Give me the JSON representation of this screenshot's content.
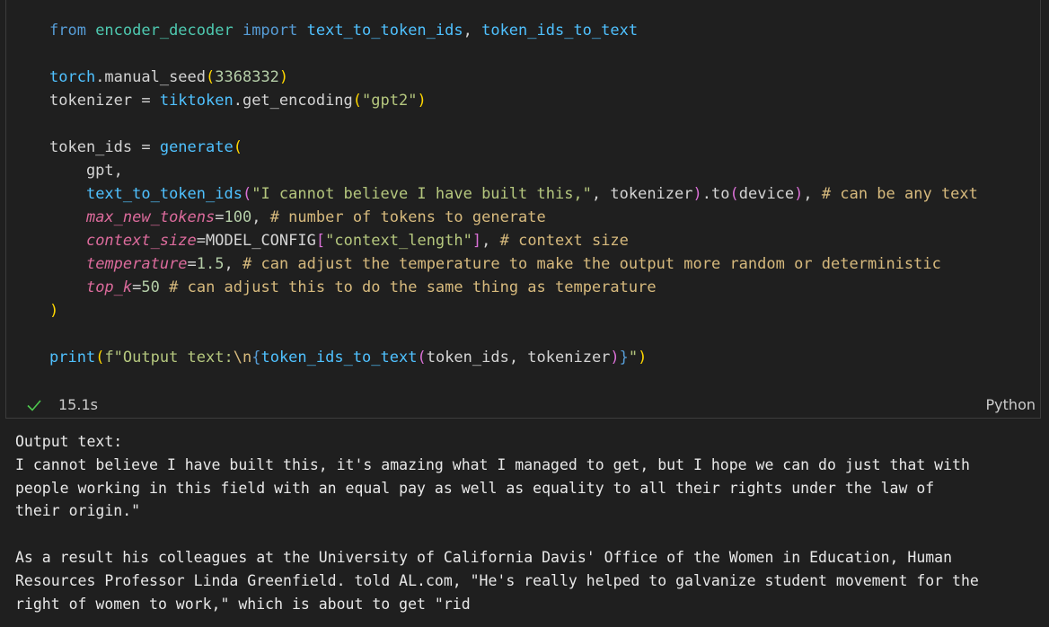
{
  "code_cell": {
    "lines": [
      [
        [
          "kw",
          "from "
        ],
        [
          "mod",
          "encoder_decoder "
        ],
        [
          "kw",
          "import "
        ],
        [
          "fn",
          "text_to_token_ids"
        ],
        [
          "vp",
          ", "
        ],
        [
          "fn",
          "token_ids_to_text"
        ]
      ],
      [],
      [
        [
          "fn",
          "torch"
        ],
        [
          "vp",
          ".manual_seed"
        ],
        [
          "par",
          "("
        ],
        [
          "numg",
          "3368332"
        ],
        [
          "par",
          ")"
        ]
      ],
      [
        [
          "vp",
          "tokenizer = "
        ],
        [
          "fn",
          "tiktoken"
        ],
        [
          "vp",
          ".get_encoding"
        ],
        [
          "par",
          "("
        ],
        [
          "strg",
          "\"gpt2\""
        ],
        [
          "par",
          ")"
        ]
      ],
      [],
      [
        [
          "vp",
          "token_ids = "
        ],
        [
          "fn",
          "generate"
        ],
        [
          "par",
          "("
        ]
      ],
      [
        [
          "vp",
          "    gpt,"
        ]
      ],
      [
        [
          "vp",
          "    "
        ],
        [
          "fn",
          "text_to_token_ids"
        ],
        [
          "par2",
          "("
        ],
        [
          "strg",
          "\"I cannot believe I have built this,\""
        ],
        [
          "vp",
          ", tokenizer"
        ],
        [
          "par2",
          ")"
        ],
        [
          "vp",
          "."
        ],
        [
          "vp",
          "to"
        ],
        [
          "par2",
          "("
        ],
        [
          "vp",
          "device"
        ],
        [
          "par2",
          ")"
        ],
        [
          "vp",
          ", "
        ],
        [
          "cmt",
          "# can be any text"
        ]
      ],
      [
        [
          "vp",
          "    "
        ],
        [
          "kwa",
          "max_new_tokens"
        ],
        [
          "eq",
          "="
        ],
        [
          "numg",
          "100"
        ],
        [
          "vp",
          ", "
        ],
        [
          "cmt",
          "# number of tokens to generate"
        ]
      ],
      [
        [
          "vp",
          "    "
        ],
        [
          "kwa",
          "context_size"
        ],
        [
          "eq",
          "="
        ],
        [
          "vp",
          "MODEL_CONFIG"
        ],
        [
          "par2",
          "["
        ],
        [
          "strg",
          "\"context_length\""
        ],
        [
          "par2",
          "]"
        ],
        [
          "vp",
          ", "
        ],
        [
          "cmt",
          "# context size"
        ]
      ],
      [
        [
          "vp",
          "    "
        ],
        [
          "kwa",
          "temperature"
        ],
        [
          "eq",
          "="
        ],
        [
          "numg",
          "1.5"
        ],
        [
          "vp",
          ", "
        ],
        [
          "cmt",
          "# can adjust the temperature to make the output more random or deterministic"
        ]
      ],
      [
        [
          "vp",
          "    "
        ],
        [
          "kwa",
          "top_k"
        ],
        [
          "eq",
          "="
        ],
        [
          "numg",
          "50"
        ],
        [
          "vp",
          " "
        ],
        [
          "cmt",
          "# can adjust this to do the same thing as temperature"
        ]
      ],
      [
        [
          "par",
          ")"
        ]
      ],
      [],
      [
        [
          "fn",
          "print"
        ],
        [
          "par",
          "("
        ],
        [
          "strg",
          "f\"Output text:"
        ],
        [
          "esc",
          "\\n"
        ],
        [
          "br2",
          "{"
        ],
        [
          "fn",
          "token_ids_to_text"
        ],
        [
          "par2",
          "("
        ],
        [
          "vp",
          "token_ids, tokenizer"
        ],
        [
          "par2",
          ")"
        ],
        [
          "br2",
          "}"
        ],
        [
          "strg",
          "\""
        ],
        [
          "par",
          ")"
        ]
      ]
    ]
  },
  "status": {
    "duration": "15.1s",
    "language": "Python",
    "success_color": "#4ec94e"
  },
  "output": {
    "lines": [
      "Output text:",
      "I cannot believe I have built this, it's amazing what I managed to get, but I hope we can do just that with",
      "people working in this field with an equal pay as well as equality to all their rights under the law of",
      "their origin.\"",
      "",
      "As a result his colleagues at the University of California Davis' Office of the Women in Education, Human",
      "Resources Professor Linda Greenfield. told AL.com, \"He's really helped to galvanize student movement for the",
      "right of women to work,\" which is about to get \"rid"
    ]
  }
}
